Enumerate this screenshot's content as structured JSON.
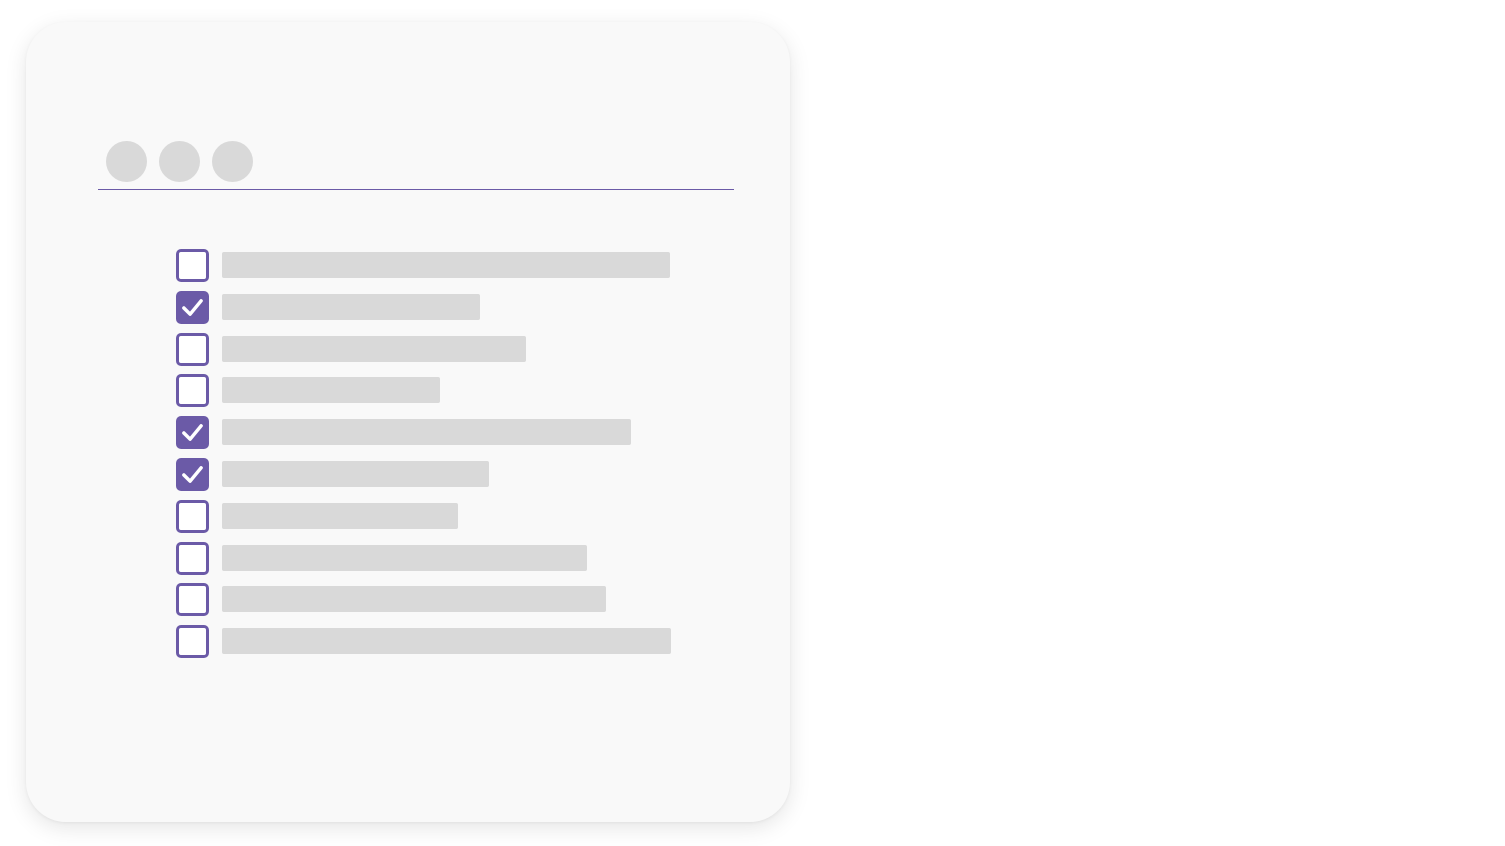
{
  "window": {
    "dots": [
      "dot-1",
      "dot-2",
      "dot-3"
    ]
  },
  "colors": {
    "accent": "#6b5aa7",
    "placeholder": "#d9d9d9",
    "card": "#f9f9f9"
  },
  "icons": {
    "checkmark": "check-icon"
  },
  "checklist": {
    "items": [
      {
        "checked": false
      },
      {
        "checked": true
      },
      {
        "checked": false
      },
      {
        "checked": false
      },
      {
        "checked": true
      },
      {
        "checked": true
      },
      {
        "checked": false
      },
      {
        "checked": false
      },
      {
        "checked": false
      },
      {
        "checked": false
      }
    ]
  }
}
